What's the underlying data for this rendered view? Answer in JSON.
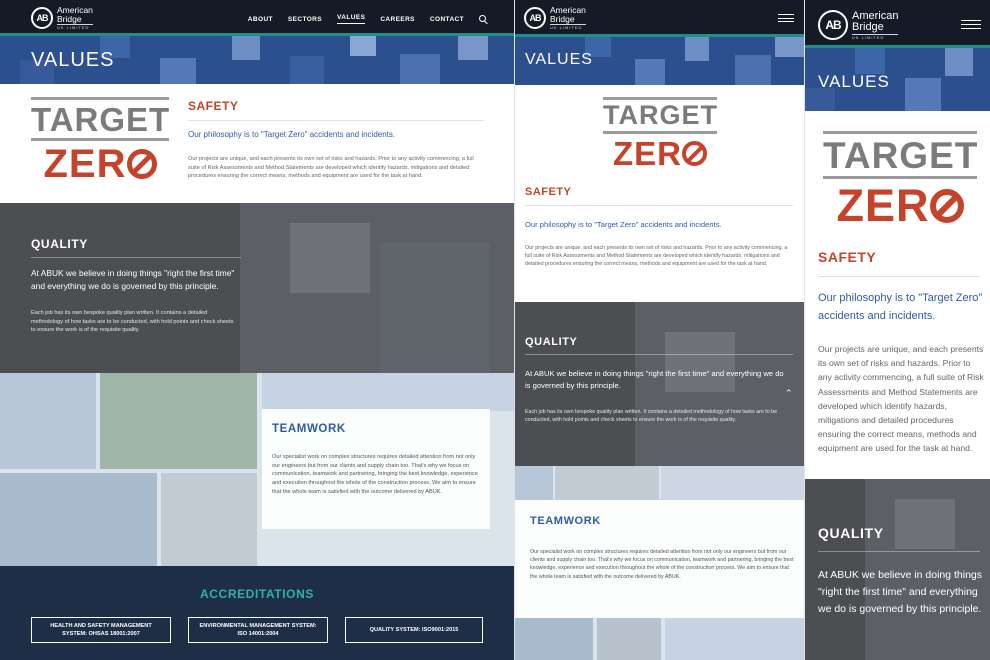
{
  "brand": {
    "mark": "AB",
    "name_line1": "American",
    "name_line2": "Bridge",
    "name_line3": "UK LIMITED"
  },
  "nav": {
    "items": [
      "ABOUT",
      "SECTORS",
      "VALUES",
      "CAREERS",
      "CONTACT"
    ],
    "active": "VALUES",
    "search_icon": "search-icon",
    "menu_icon": "hamburger-menu-icon"
  },
  "hero": {
    "title": "VALUES"
  },
  "target_zero": {
    "line1": "TARGET",
    "line2_prefix": "ZER"
  },
  "safety": {
    "heading": "SAFETY",
    "lead": "Our philosophy is to \"Target Zero\" accidents and incidents.",
    "body": "Our projects are unique, and each presents its own set of risks and hazards. Prior to any activity commencing, a full suite of Risk Assessments and Method Statements are developed which identify hazards, mitigations and detailed procedures ensuring the correct means, methods and equipment are used for the task at hand."
  },
  "quality": {
    "heading": "QUALITY",
    "lead": "At ABUK we believe in doing things \"right the first time\" and everything we do is governed by this principle.",
    "body": "Each job has its own bespoke quality plan written. It contains a detailed methodology of how tasks are to be conducted, with hold points and check sheets to ensure the work is of the requisite quality."
  },
  "teamwork": {
    "heading": "TEAMWORK",
    "body": "Our specialist work on complex structures requires detailed attention from not only our engineers but from our clients and supply chain too. That's why we focus on communication, teamwork and partnering, bringing the best knowledge, experience and execution throughout the whole of the construction process. We aim to ensure that the whole team is satisfied with the outcome delivered by ABUK."
  },
  "accreditations": {
    "heading": "ACCREDITATIONS",
    "items": [
      "HEALTH AND SAFETY MANAGEMENT SYSTEM: OHSAS 18001:2007",
      "ENVIRONMENTAL MANAGEMENT SYSTEM: ISO 14001:2004",
      "QUALITY SYSTEM: ISO9001:2015"
    ]
  },
  "colors": {
    "header": "#141b26",
    "hero_blue": "#2c4f8e",
    "accent_red": "#c5432b",
    "link_blue": "#2d5ca7",
    "teal": "#2fb1a8",
    "navy": "#1f2e47"
  }
}
